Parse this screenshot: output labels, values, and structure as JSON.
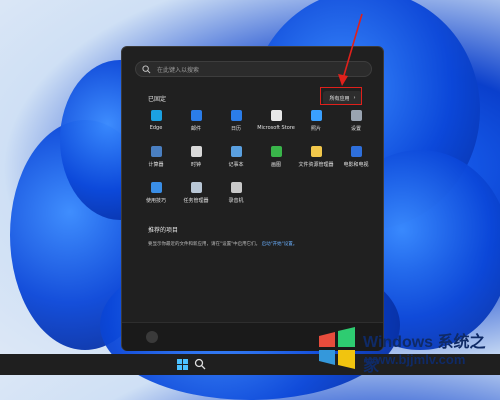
{
  "search": {
    "placeholder": "在此键入以搜索"
  },
  "pinned": {
    "title": "已固定",
    "all_apps_label": "所有应用",
    "apps": [
      {
        "label": "Edge",
        "icon": "edge-icon",
        "color": "#1ba1e2"
      },
      {
        "label": "邮件",
        "icon": "mail-icon",
        "color": "#2b7de9"
      },
      {
        "label": "日历",
        "icon": "calendar-icon",
        "color": "#2b7de9"
      },
      {
        "label": "Microsoft Store",
        "icon": "store-icon",
        "color": "#e8e8e8"
      },
      {
        "label": "照片",
        "icon": "photos-icon",
        "color": "#3aa0ff"
      },
      {
        "label": "设置",
        "icon": "settings-icon",
        "color": "#9aa4b1"
      },
      {
        "label": "计算器",
        "icon": "calculator-icon",
        "color": "#4a7fc1"
      },
      {
        "label": "时钟",
        "icon": "clock-icon",
        "color": "#d9d9d9"
      },
      {
        "label": "记事本",
        "icon": "notepad-icon",
        "color": "#5aa0e0"
      },
      {
        "label": "画图",
        "icon": "paint-icon",
        "color": "#39b54a"
      },
      {
        "label": "文件资源管理器",
        "icon": "folder-icon",
        "color": "#f2c84b"
      },
      {
        "label": "电影和电视",
        "icon": "movies-icon",
        "color": "#2e6fdb"
      },
      {
        "label": "使用技巧",
        "icon": "tips-icon",
        "color": "#3a8ee6"
      },
      {
        "label": "任务管理器",
        "icon": "task-manager-icon",
        "color": "#b9c7d6"
      },
      {
        "label": "录音机",
        "icon": "recorder-icon",
        "color": "#c9c9c9"
      }
    ]
  },
  "recommended": {
    "title": "推荐的项目",
    "text": "要显示你最近的文件和新应用，请在\"设置\"中启用它们。",
    "link": "启动\"开始\"设置。"
  },
  "watermark": {
    "title_en": "Windows",
    "title_cn": "系统之家",
    "url": "www.bjjmlv.com"
  }
}
